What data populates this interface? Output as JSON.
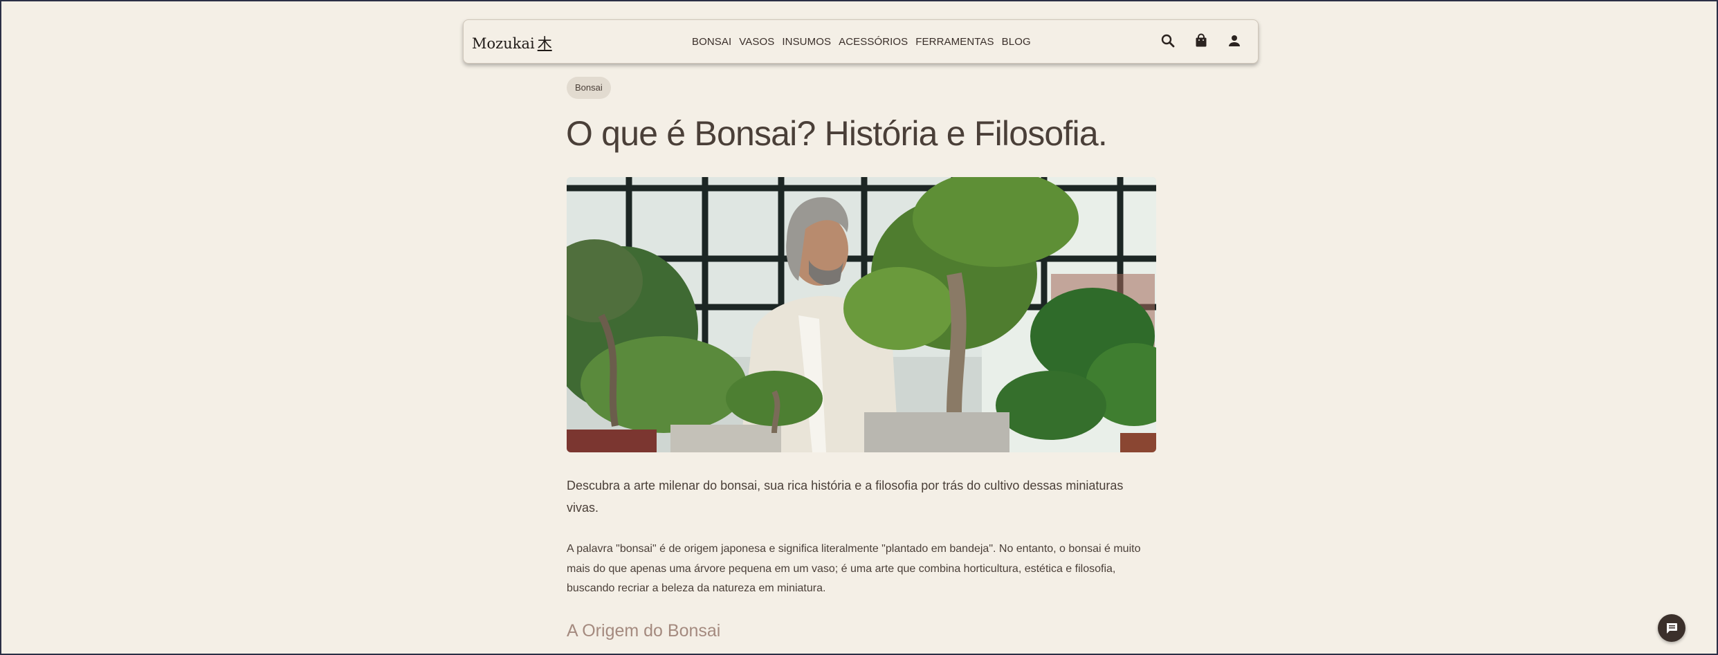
{
  "header": {
    "logo_text": "Mozukai",
    "logo_kanji": "木",
    "nav": [
      "BONSAI",
      "VASOS",
      "INSUMOS",
      "ACESSÓRIOS",
      "FERRAMENTAS",
      "BLOG"
    ],
    "icons": [
      "search-icon",
      "shopping-bag-icon",
      "user-icon"
    ]
  },
  "article": {
    "category_badge": "Bonsai",
    "title": "O que é Bonsai? História e Filosofia.",
    "hero_image": "photo of a man pruning bonsai trees in a greenhouse",
    "lead": "Descubra a arte milenar do bonsai, sua rica história e a filosofia por trás do cultivo dessas miniaturas vivas.",
    "paragraph_1": "A palavra \"bonsai\" é de origem japonesa e significa literalmente \"plantado em bandeja\". No entanto, o bonsai é muito mais do que apenas uma árvore pequena em um vaso; é uma arte que combina horticultura, estética e filosofia, buscando recriar a beleza da natureza em miniatura.",
    "section_heading": "A Origem do Bonsai"
  },
  "chat": {
    "icon": "chat-icon"
  },
  "colors": {
    "background": "#f4efe6",
    "text": "#4a3f38",
    "accent_heading": "#a48a7f",
    "badge_bg": "#e2dbd0",
    "dark": "#3b302b"
  }
}
